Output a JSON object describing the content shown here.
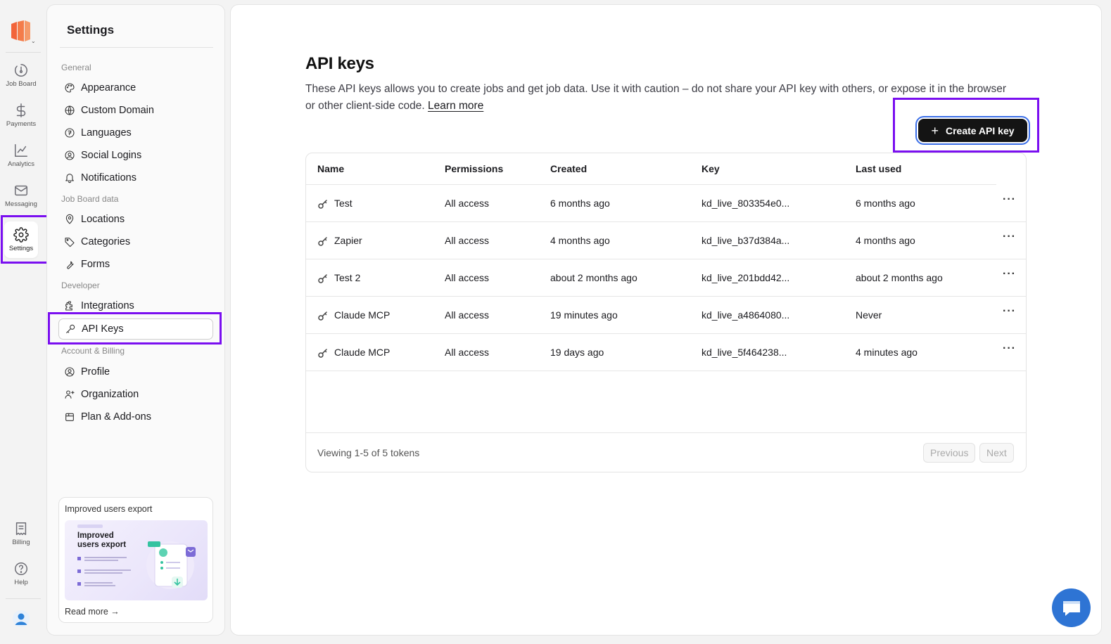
{
  "rail": {
    "items": [
      {
        "label": "Job Board",
        "icon": "job-board-icon"
      },
      {
        "label": "Payments",
        "icon": "dollar-icon"
      },
      {
        "label": "Analytics",
        "icon": "chart-icon"
      },
      {
        "label": "Messaging",
        "icon": "mail-icon"
      },
      {
        "label": "Settings",
        "icon": "gear-icon"
      }
    ],
    "bottom": [
      {
        "label": "Billing",
        "icon": "receipt-icon"
      },
      {
        "label": "Help",
        "icon": "help-icon"
      }
    ],
    "logo_color": "#f2643a"
  },
  "settings": {
    "title": "Settings",
    "groups": [
      {
        "label": "General",
        "items": [
          "Appearance",
          "Custom Domain",
          "Languages",
          "Social Logins",
          "Notifications"
        ]
      },
      {
        "label": "Job Board data",
        "items": [
          "Locations",
          "Categories",
          "Forms"
        ]
      },
      {
        "label": "Developer",
        "items": [
          "Integrations",
          "API Keys"
        ]
      },
      {
        "label": "Account & Billing",
        "items": [
          "Profile",
          "Organization",
          "Plan & Add-ons"
        ]
      }
    ],
    "active": "API Keys",
    "promo": {
      "title": "Improved users export",
      "image_title": "Improved users export",
      "link": "Read more →"
    }
  },
  "main": {
    "title": "API keys",
    "description": "These API keys allows you to create jobs and get job data. Use it with caution – do not share your API key with others, or expose it in the browser or other client-side code.",
    "learn_more": "Learn more",
    "create_button": "Create API key",
    "table": {
      "columns": [
        "Name",
        "Permissions",
        "Created",
        "Key",
        "Last used"
      ],
      "rows": [
        {
          "name": "Test",
          "permissions": "All access",
          "created": "6 months ago",
          "key": "kd_live_803354e0...",
          "last_used": "6 months ago"
        },
        {
          "name": "Zapier",
          "permissions": "All access",
          "created": "4 months ago",
          "key": "kd_live_b37d384a...",
          "last_used": "4 months ago"
        },
        {
          "name": "Test 2",
          "permissions": "All access",
          "created": "about 2 months ago",
          "key": "kd_live_201bdd42...",
          "last_used": "about 2 months ago"
        },
        {
          "name": "Claude MCP",
          "permissions": "All access",
          "created": "19 minutes ago",
          "key": "kd_live_a4864080...",
          "last_used": "Never"
        },
        {
          "name": "Claude MCP",
          "permissions": "All access",
          "created": "19 days ago",
          "key": "kd_live_5f464238...",
          "last_used": "4 minutes ago"
        }
      ],
      "footer": "Viewing 1-5 of 5 tokens",
      "prev": "Previous",
      "next": "Next"
    }
  },
  "colors": {
    "highlight": "#7a0ff0",
    "chat": "#2e74d4"
  }
}
